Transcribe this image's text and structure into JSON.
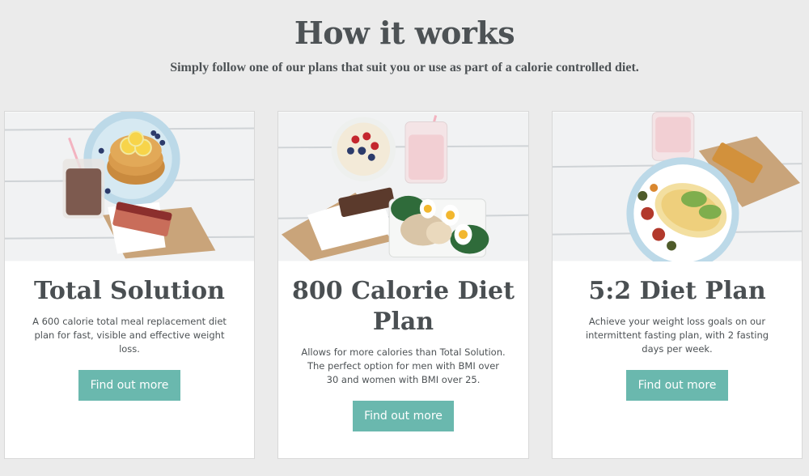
{
  "header": {
    "title": "How it works",
    "subtitle": "Simply follow one of our plans that suit you or use as part of a calorie controlled diet."
  },
  "cards": [
    {
      "title": "Total Solution",
      "description": "A 600 calorie total meal replacement diet plan for fast, visible and effective weight loss.",
      "button_label": "Find out more",
      "photo": "pancakes-with-chocolate-shake-and-bar"
    },
    {
      "title": "800 Calorie Diet Plan",
      "description": "Allows for more calories than Total Solution. The perfect option for men with BMI over 30 and women with BMI over 25.",
      "button_label": "Find out more",
      "photo": "porridge-shake-bar-and-chicken-salad"
    },
    {
      "title": "5:2 Diet Plan",
      "description": "Achieve your weight loss goals on our intermittent fasting plan, with 2 fasting days per week.",
      "button_label": "Find out more",
      "photo": "omelette-with-shake-and-bar"
    }
  ],
  "colors": {
    "page_background": "#ebebeb",
    "heading_text": "#4d5255",
    "button_accent": "#6ab8ae",
    "button_text": "#ffffff",
    "card_background": "#ffffff"
  }
}
